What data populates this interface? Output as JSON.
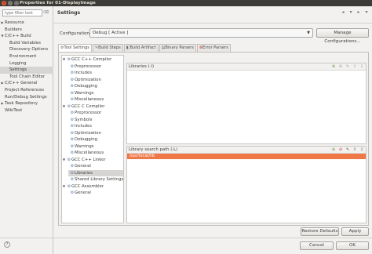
{
  "window": {
    "title": "Properties for 01-DisplayImage"
  },
  "sidebar": {
    "filter_placeholder": "type filter text",
    "items": [
      {
        "label": "Resource",
        "indent": 0,
        "expandable": true
      },
      {
        "label": "Builders",
        "indent": 0,
        "expandable": false
      },
      {
        "label": "C/C++ Build",
        "indent": 0,
        "expandable": true,
        "expanded": true
      },
      {
        "label": "Build Variables",
        "indent": 1,
        "expandable": false
      },
      {
        "label": "Discovery Options",
        "indent": 1,
        "expandable": false
      },
      {
        "label": "Environment",
        "indent": 1,
        "expandable": false
      },
      {
        "label": "Logging",
        "indent": 1,
        "expandable": false
      },
      {
        "label": "Settings",
        "indent": 1,
        "expandable": false,
        "selected": true
      },
      {
        "label": "Tool Chain Editor",
        "indent": 1,
        "expandable": false
      },
      {
        "label": "C/C++ General",
        "indent": 0,
        "expandable": true
      },
      {
        "label": "Project References",
        "indent": 0,
        "expandable": false
      },
      {
        "label": "Run/Debug Settings",
        "indent": 0,
        "expandable": false
      },
      {
        "label": "Task Repository",
        "indent": 0,
        "expandable": true
      },
      {
        "label": "WikiText",
        "indent": 0,
        "expandable": false
      }
    ]
  },
  "main": {
    "heading": "Settings",
    "configuration_label": "Configuration:",
    "configuration_value": "Debug [ Active ]",
    "manage_button": "Manage Configurations...",
    "tabs": [
      {
        "label": "Tool Settings",
        "icon": "tool-icon",
        "active": true
      },
      {
        "label": "Build Steps",
        "icon": "wrench-icon",
        "active": false
      },
      {
        "label": "Build Artifact",
        "icon": "artifact-icon",
        "active": false
      },
      {
        "label": "Binary Parsers",
        "icon": "binary-icon",
        "active": false
      },
      {
        "label": "Error Parsers",
        "icon": "error-icon",
        "active": false
      }
    ],
    "tool_tree": [
      {
        "label": "GCC C++ Compiler",
        "level": 0,
        "expanded": true
      },
      {
        "label": "Preprocessor",
        "level": 1
      },
      {
        "label": "Includes",
        "level": 1
      },
      {
        "label": "Optimization",
        "level": 1
      },
      {
        "label": "Debugging",
        "level": 1
      },
      {
        "label": "Warnings",
        "level": 1
      },
      {
        "label": "Miscellaneous",
        "level": 1
      },
      {
        "label": "GCC C Compiler",
        "level": 0,
        "expanded": true
      },
      {
        "label": "Preprocessor",
        "level": 1
      },
      {
        "label": "Symbols",
        "level": 1
      },
      {
        "label": "Includes",
        "level": 1
      },
      {
        "label": "Optimization",
        "level": 1
      },
      {
        "label": "Debugging",
        "level": 1
      },
      {
        "label": "Warnings",
        "level": 1
      },
      {
        "label": "Miscellaneous",
        "level": 1
      },
      {
        "label": "GCC C++ Linker",
        "level": 0,
        "expanded": true
      },
      {
        "label": "General",
        "level": 1
      },
      {
        "label": "Libraries",
        "level": 1,
        "selected": true
      },
      {
        "label": "Shared Library Settings",
        "level": 1
      },
      {
        "label": "GCC Assembler",
        "level": 0,
        "expanded": true
      },
      {
        "label": "General",
        "level": 1
      }
    ],
    "libraries_panel": {
      "title": "Libraries (-l)",
      "items": []
    },
    "library_path_panel": {
      "title": "Library search path (-L)",
      "items": [
        "/usr/local/lib"
      ]
    },
    "restore_defaults_button": "Restore Defaults",
    "apply_button": "Apply"
  },
  "footer": {
    "cancel_button": "Cancel",
    "ok_button": "OK"
  },
  "colors": {
    "titlebar": "#3c3b37",
    "selection": "#f07746",
    "close_button": "#e9572c"
  }
}
